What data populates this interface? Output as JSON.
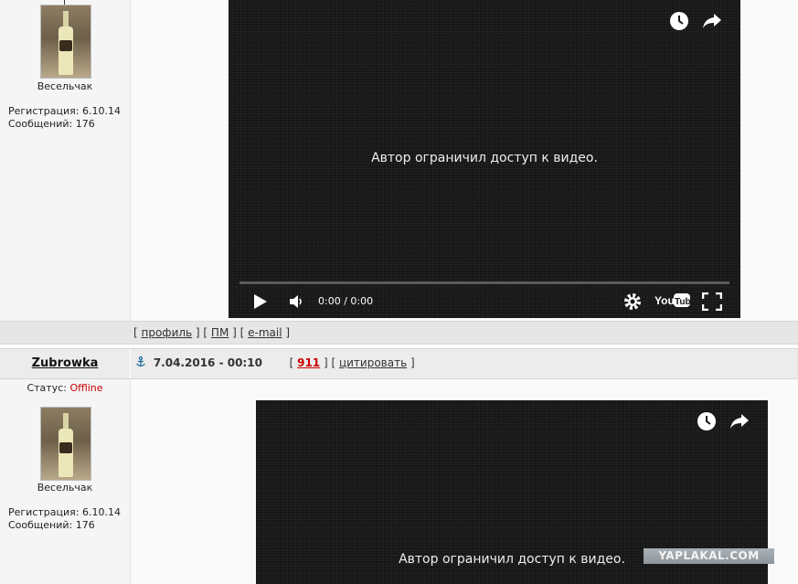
{
  "post1": {
    "author_rank": "Весельчак",
    "registration": "Регистрация: 6.10.14",
    "messages": "Сообщений: 176",
    "video": {
      "message": "Автор ограничил доступ к видео.",
      "time": "0:00 / 0:00",
      "icons": [
        "watch-later-icon",
        "share-icon",
        "play-icon",
        "volume-icon",
        "settings-icon",
        "youtube-logo",
        "fullscreen-icon"
      ]
    },
    "links": {
      "open1": "[ ",
      "profile": "профиль",
      "close1": " ] [ ",
      "pm": "ПМ",
      "close2": " ] [ ",
      "email": "e-mail",
      "close3": " ]"
    }
  },
  "post2": {
    "username": "Zubrowka",
    "date": "7.04.2016 - 00:10",
    "num_open": "[ ",
    "number": "911",
    "num_close": " ] [ ",
    "quote": "цитировать",
    "quote_close": " ]",
    "status_label": "Статус: ",
    "status_value": "Offline",
    "author_rank": "Весельчак",
    "registration": "Регистрация: 6.10.14",
    "messages": "Сообщений: 176",
    "video": {
      "message": "Автор ограничил доступ к видео."
    }
  },
  "watermark": "YAPLAKAL.COM",
  "colors": {
    "offline": "#cc0000",
    "post_number": "#cc0000",
    "video_bg": "#161616"
  }
}
